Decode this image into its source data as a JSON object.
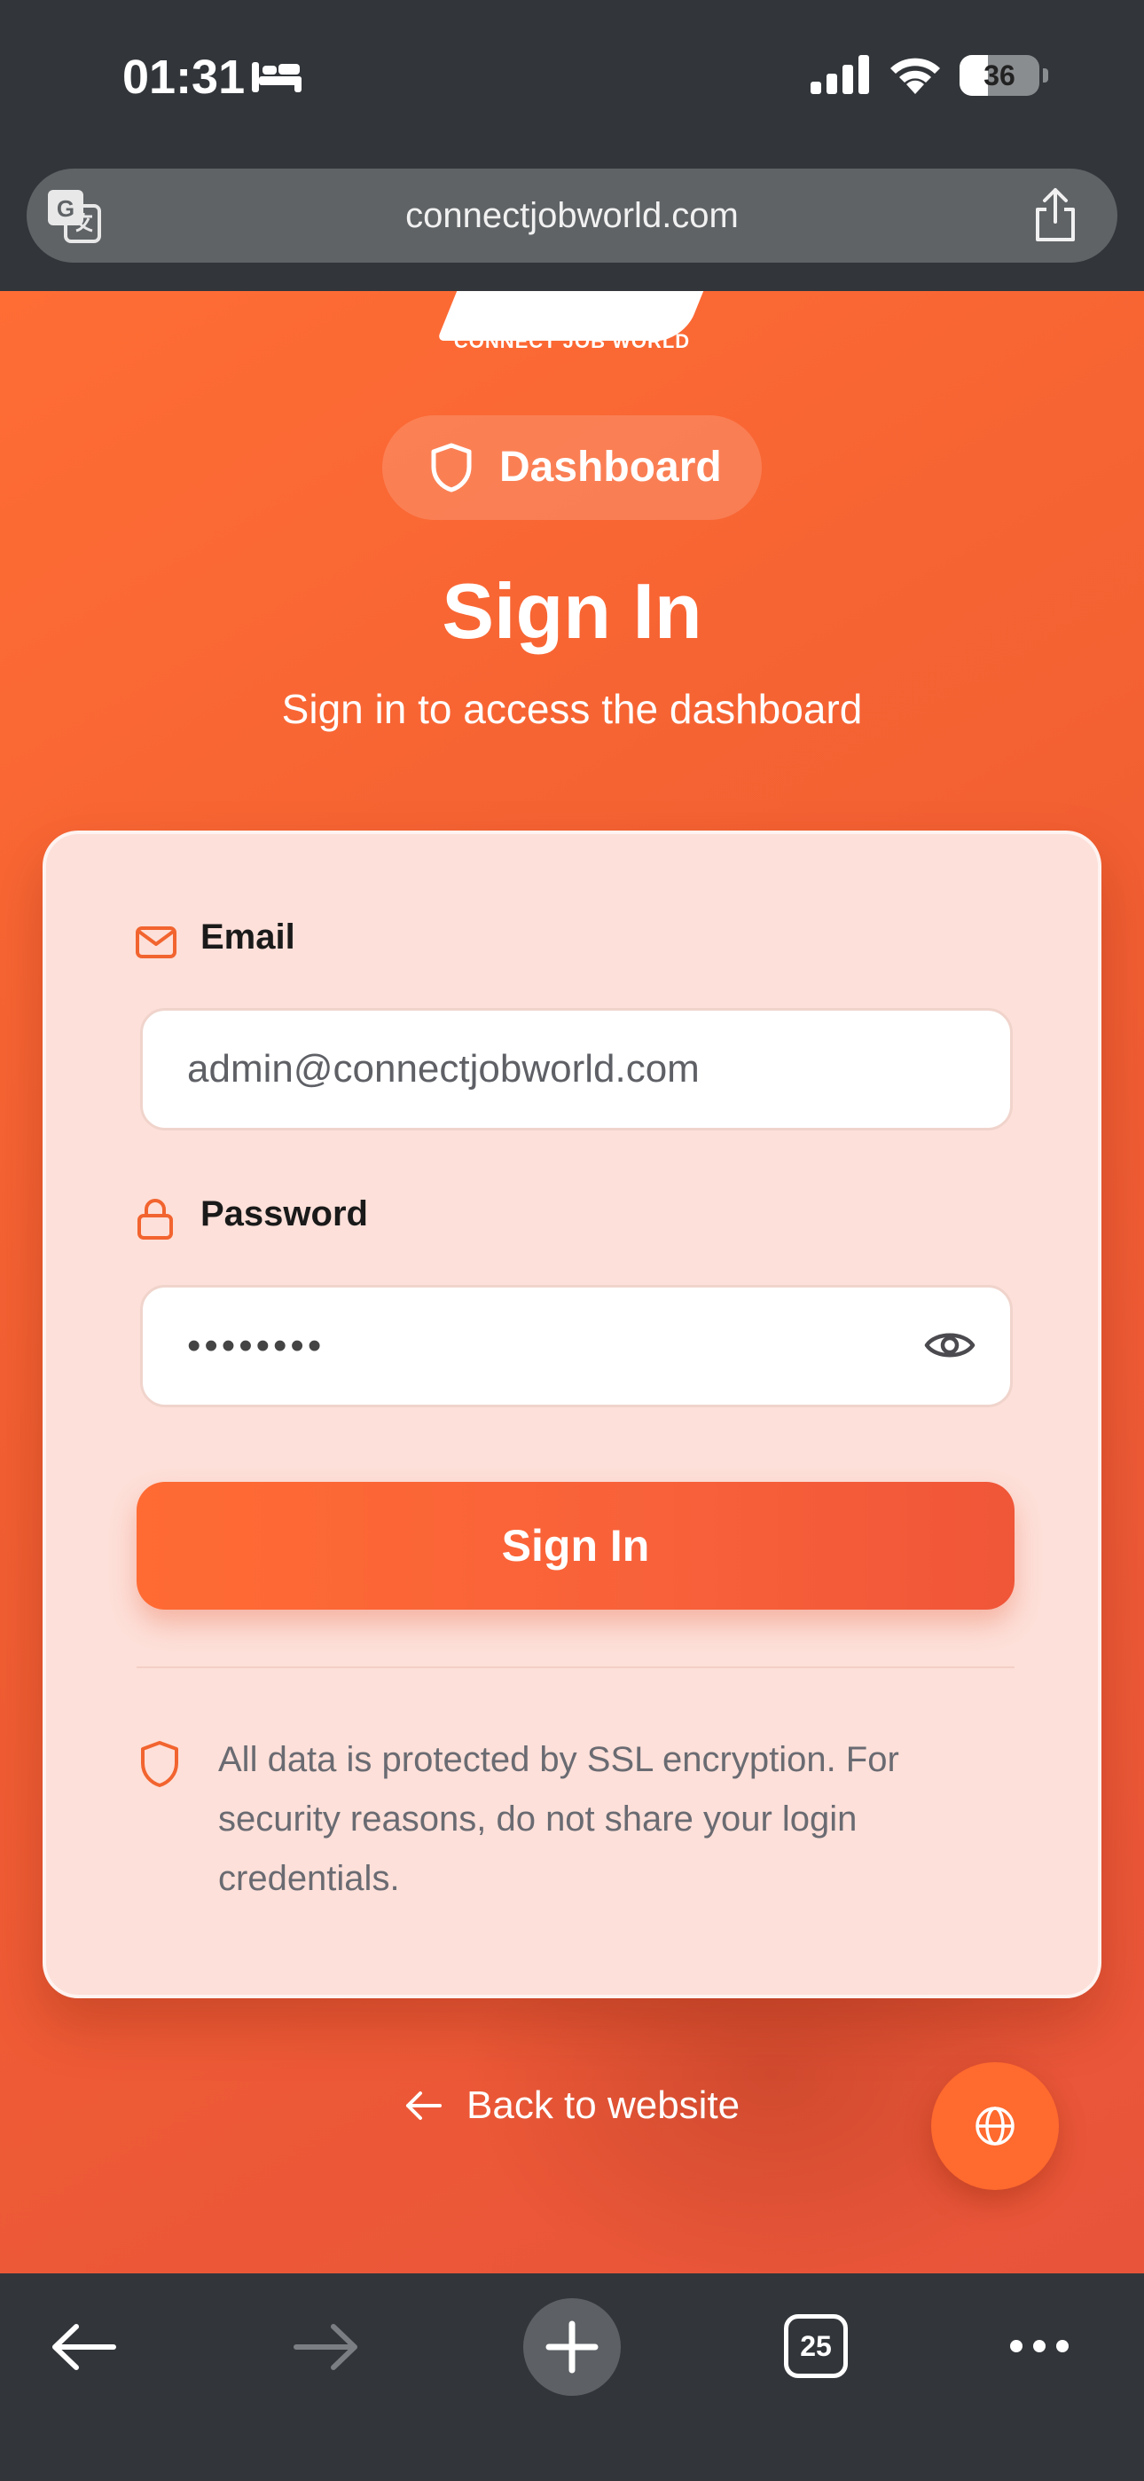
{
  "status_bar": {
    "time": "01:31",
    "battery_level": 36,
    "battery_text": "36"
  },
  "browser": {
    "url": "connectjobworld.com",
    "open_tabs": "25"
  },
  "logo": {
    "text": "CONNECT JOB WORLD"
  },
  "header": {
    "badge_label": "Dashboard",
    "title": "Sign In",
    "subtitle": "Sign in to access the dashboard"
  },
  "form": {
    "email_label": "Email",
    "email_value": "admin@connectjobworld.com",
    "password_label": "Password",
    "password_value": "••••••••",
    "submit_label": "Sign In",
    "notice": "All data is protected by SSL encryption. For security reasons, do not share your login credentials."
  },
  "footer": {
    "back_label": "Back to website"
  },
  "colors": {
    "accent": "#ff6b33",
    "card_bg": "#fde0d9",
    "chrome_bg": "#32363a"
  },
  "icons": {
    "badge": "shield-icon",
    "email": "mail-icon",
    "password": "lock-icon",
    "toggle_password": "eye-icon",
    "notice": "shield-icon",
    "back": "arrow-left-icon",
    "language": "globe-icon"
  }
}
